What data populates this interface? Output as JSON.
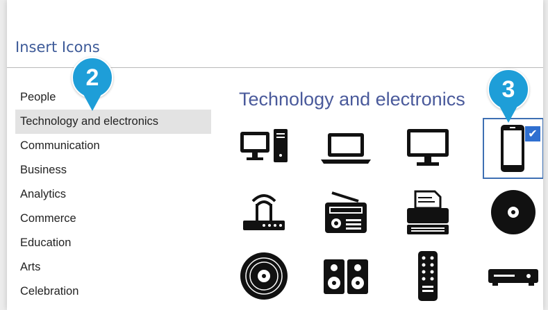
{
  "dialog": {
    "title": "Insert Icons"
  },
  "categories": [
    {
      "label": "People"
    },
    {
      "label": "Technology and electronics",
      "selected": true
    },
    {
      "label": "Communication"
    },
    {
      "label": "Business"
    },
    {
      "label": "Analytics"
    },
    {
      "label": "Commerce"
    },
    {
      "label": "Education"
    },
    {
      "label": "Arts"
    },
    {
      "label": "Celebration"
    }
  ],
  "section": {
    "heading": "Technology and electronics"
  },
  "icons": [
    {
      "name": "desktop-tower-icon"
    },
    {
      "name": "laptop-icon"
    },
    {
      "name": "monitor-icon"
    },
    {
      "name": "smartphone-icon",
      "selected": true,
      "check": "✔"
    },
    {
      "name": "wifi-router-icon"
    },
    {
      "name": "radio-icon"
    },
    {
      "name": "printer-icon"
    },
    {
      "name": "disc-icon"
    },
    {
      "name": "vinyl-record-icon"
    },
    {
      "name": "speakers-icon"
    },
    {
      "name": "remote-control-icon"
    },
    {
      "name": "dvd-player-icon"
    }
  ],
  "callouts": [
    {
      "label": "2"
    },
    {
      "label": "3"
    }
  ],
  "colors": {
    "accent": "#1e9ed8",
    "title_text": "#3d5a98",
    "selection_border": "#3e6fb3",
    "selected_row": "#e3e3e3"
  }
}
